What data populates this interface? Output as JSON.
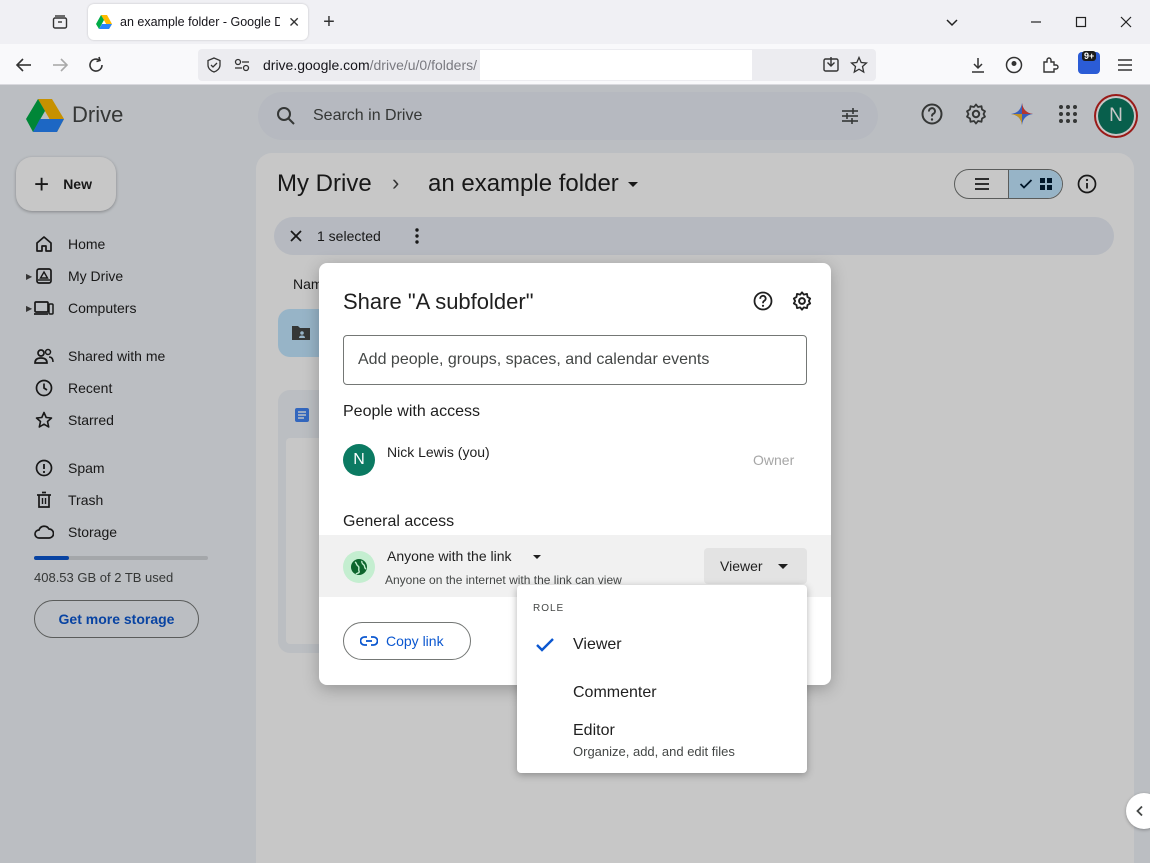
{
  "browser": {
    "tab_title": "an example folder - Google Drive",
    "url_domain": "drive.google.com",
    "url_path": "/drive/u/0/folders/",
    "extension_badge": "9+"
  },
  "header": {
    "app_name": "Drive",
    "search_placeholder": "Search in Drive",
    "avatar_initial": "N"
  },
  "sidebar": {
    "new_label": "New",
    "items": [
      {
        "label": "Home",
        "icon": "home-icon"
      },
      {
        "label": "My Drive",
        "icon": "my-drive-icon"
      },
      {
        "label": "Computers",
        "icon": "computers-icon"
      },
      {
        "label": "Shared with me",
        "icon": "shared-icon"
      },
      {
        "label": "Recent",
        "icon": "recent-icon"
      },
      {
        "label": "Starred",
        "icon": "star-icon"
      },
      {
        "label": "Spam",
        "icon": "spam-icon"
      },
      {
        "label": "Trash",
        "icon": "trash-icon"
      },
      {
        "label": "Storage",
        "icon": "cloud-icon"
      }
    ],
    "storage_used_fraction": 0.2,
    "storage_text": "408.53 GB of 2 TB used",
    "get_storage_label": "Get more storage"
  },
  "main": {
    "breadcrumb_root": "My Drive",
    "breadcrumb_current": "an example folder",
    "selection_text": "1 selected",
    "column_name": "Nam"
  },
  "share_dialog": {
    "title": "Share \"A subfolder\"",
    "add_placeholder": "Add people, groups, spaces, and calendar events",
    "people_header": "People with access",
    "person": {
      "initial": "N",
      "name": "Nick Lewis (you)",
      "role": "Owner"
    },
    "general_header": "General access",
    "access_type": "Anyone with the link",
    "access_description": "Anyone on the internet with the link can view",
    "current_role": "Viewer",
    "copy_link_label": "Copy link"
  },
  "role_menu": {
    "header": "ROLE",
    "items": [
      {
        "label": "Viewer",
        "selected": true
      },
      {
        "label": "Commenter",
        "selected": false
      },
      {
        "label": "Editor",
        "description": "Organize, add, and edit files",
        "selected": false
      }
    ]
  },
  "colors": {
    "accent": "#0b57d0",
    "avatar": "#0b7a62",
    "selected_toggle": "#c2e7ff"
  }
}
